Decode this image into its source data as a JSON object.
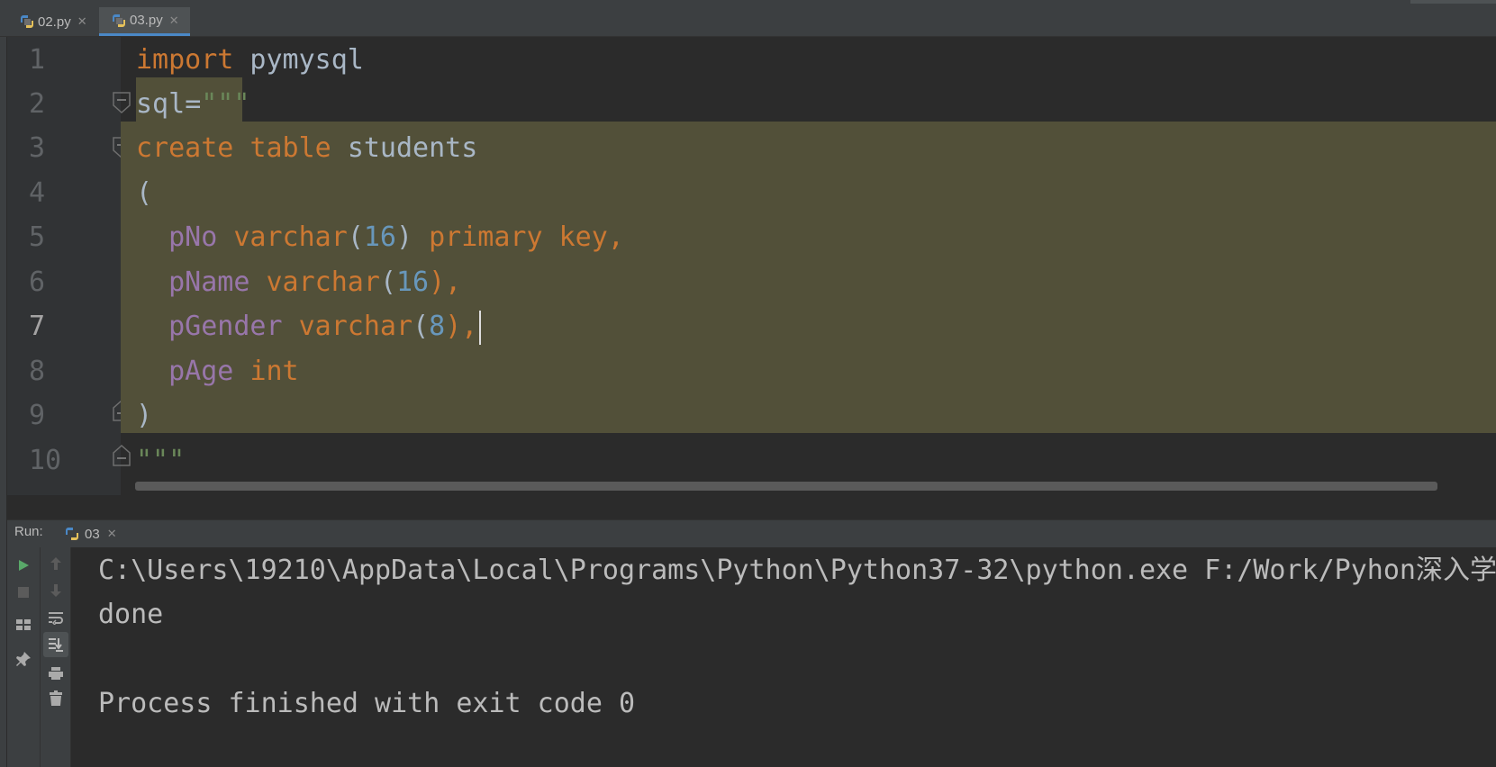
{
  "tabs": [
    {
      "label": "02.py",
      "active": false
    },
    {
      "label": "03.py",
      "active": true
    }
  ],
  "editor": {
    "line_numbers": [
      "1",
      "2",
      "3",
      "4",
      "5",
      "6",
      "7",
      "8",
      "9",
      "10"
    ],
    "current_line": "7"
  },
  "code": {
    "l1": {
      "kw": "import",
      "rest": " pymysql"
    },
    "l2": {
      "ident": "sql",
      "op": "=",
      "str": "\"\"\""
    },
    "l3": {
      "kw1": "create",
      "kw2": "table",
      "name": "students"
    },
    "l4": {
      "paren": "("
    },
    "l5": {
      "field": "pNo",
      "type": "varchar",
      "open": "(",
      "num": "16",
      "close": ")",
      "kw": "primary key,"
    },
    "l6": {
      "field": "pName",
      "type": "varchar",
      "open": "(",
      "num": "16",
      "close": "),"
    },
    "l7": {
      "field": "pGender",
      "type": "varchar",
      "open": "(",
      "num": "8",
      "close": "),"
    },
    "l8": {
      "field": "pAge",
      "type": "int"
    },
    "l9": {
      "paren": ")"
    },
    "l10": {
      "str": "\"\"\""
    }
  },
  "run": {
    "label": "Run:",
    "tab_label": "03",
    "output": [
      "C:\\Users\\19210\\AppData\\Local\\Programs\\Python\\Python37-32\\python.exe F:/Work/Pyhon深入学",
      "done",
      "",
      "Process finished with exit code 0"
    ]
  },
  "tools": {
    "col1": [
      "run-icon",
      "stop-icon",
      "layout-icon",
      "pin-icon"
    ],
    "col2": [
      "arrow-up-icon",
      "arrow-down-icon",
      "soft-wrap-icon",
      "scroll-to-end-icon",
      "print-icon",
      "trash-icon"
    ]
  },
  "colors": {
    "keyword": "#cc7832",
    "number": "#6897bb",
    "field": "#9876aa",
    "string": "#6a8759",
    "selection": "#525039",
    "background": "#2b2b2b"
  }
}
